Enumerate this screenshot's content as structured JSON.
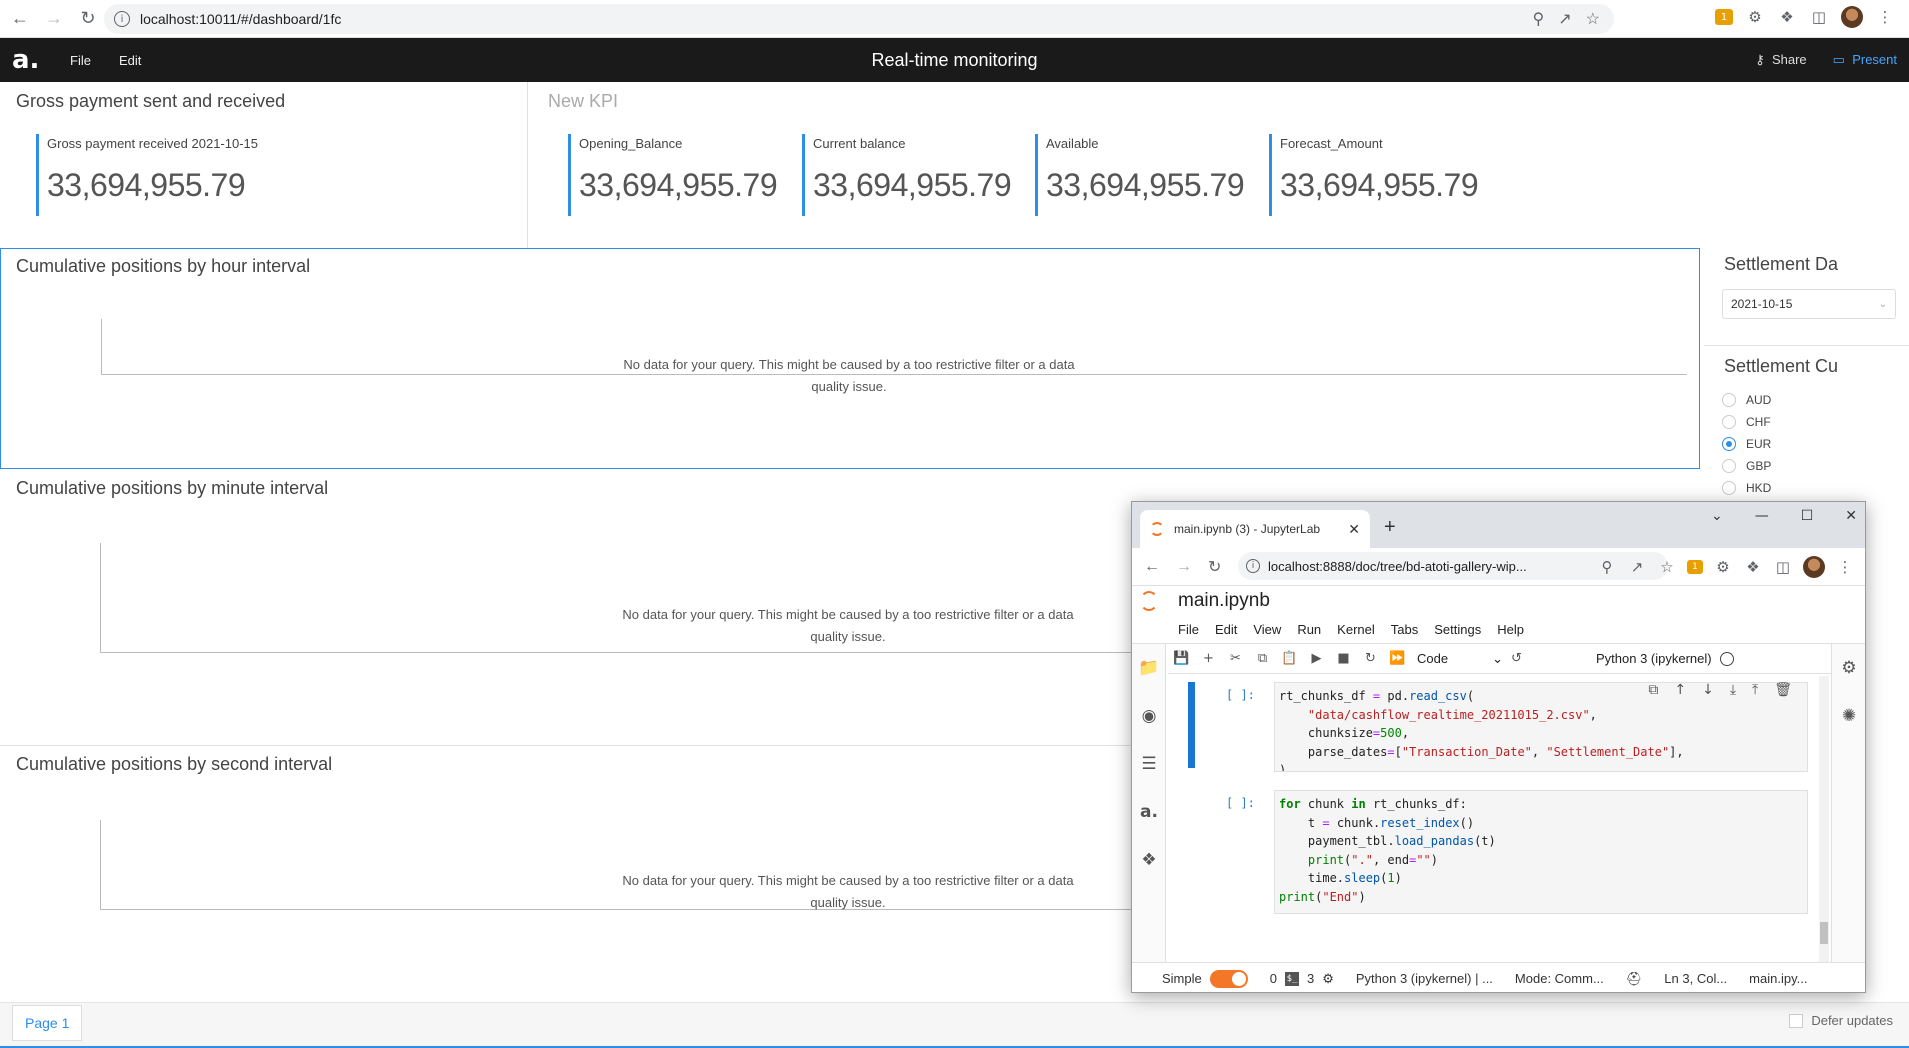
{
  "browser": {
    "url": "localhost:10011/#/dashboard/1fc"
  },
  "app": {
    "title": "Real-time monitoring",
    "menu": [
      "File",
      "Edit"
    ],
    "share_label": "Share",
    "present_label": "Present"
  },
  "kpi_panel_1": {
    "title": "Gross payment sent and received",
    "kpis": [
      {
        "label": "Gross payment received 2021-10-15",
        "value": "33,694,955.79"
      }
    ]
  },
  "kpi_panel_2": {
    "title": "New KPI",
    "kpis": [
      {
        "label": "Opening_Balance",
        "value": "33,694,955.79"
      },
      {
        "label": "Current balance",
        "value": "33,694,955.79"
      },
      {
        "label": "Available",
        "value": "33,694,955.79"
      },
      {
        "label": "Forecast_Amount",
        "value": "33,694,955.79"
      }
    ]
  },
  "charts": [
    {
      "title": "Cumulative positions by hour interval",
      "nodata_line1": "No data for your query. This might be caused by a too restrictive filter or a data",
      "nodata_line2": "quality issue."
    },
    {
      "title": "Cumulative positions by minute interval",
      "nodata_line1": "No data for your query. This might be caused by a too restrictive filter or a data",
      "nodata_line2": "quality issue."
    },
    {
      "title": "Cumulative positions by second interval",
      "nodata_line1": "No data for your query. This might be caused by a too restrictive filter or a data",
      "nodata_line2": "quality issue."
    }
  ],
  "filters": {
    "date_title": "Settlement Da",
    "date_value": "2021-10-15",
    "currency_title": "Settlement Cu",
    "currencies": [
      "AUD",
      "CHF",
      "EUR",
      "GBP",
      "HKD"
    ],
    "selected_currency": "EUR"
  },
  "footer": {
    "page_tab": "Page 1",
    "defer_label": "Defer updates"
  },
  "jupyter": {
    "tab_title": "main.ipynb (3) - JupyterLab",
    "url": "localhost:8888/doc/tree/bd-atoti-gallery-wip...",
    "notebook_name": "main.ipynb",
    "menu": [
      "File",
      "Edit",
      "View",
      "Run",
      "Kernel",
      "Tabs",
      "Settings",
      "Help"
    ],
    "cell_type": "Code",
    "kernel": "Python 3 (ipykernel)",
    "cells": [
      {
        "prompt": "[ ]:"
      },
      {
        "prompt": "[ ]:"
      }
    ],
    "status": {
      "mode_label": "Simple",
      "num1": "0",
      "num2": "3",
      "kernel": "Python 3 (ipykernel) | ...",
      "mode": "Mode: Comm...",
      "position": "Ln 3, Col...",
      "file": "main.ipy..."
    }
  },
  "colors": {
    "accent": "#2d8ee8",
    "topbar": "#1a1a1a",
    "jupyter_orange": "#f37726"
  }
}
